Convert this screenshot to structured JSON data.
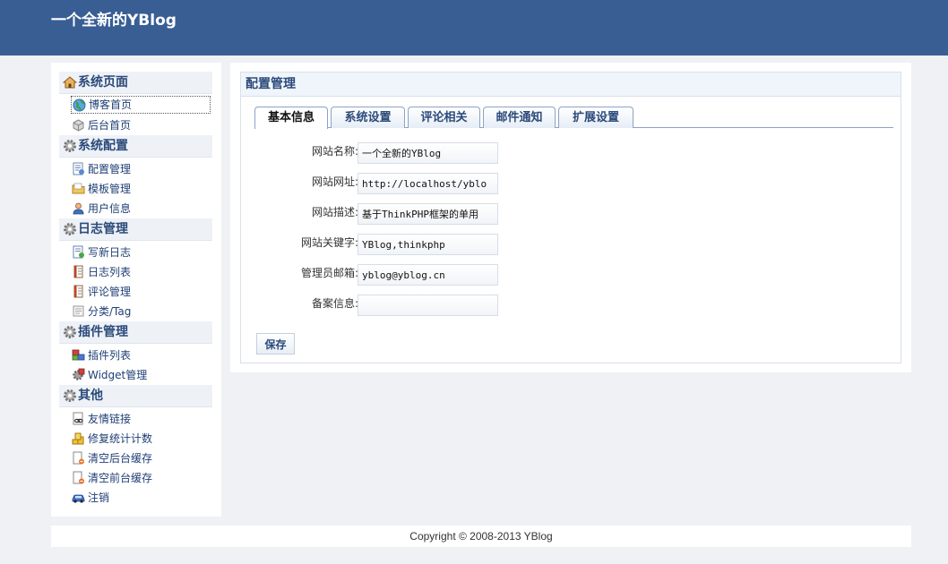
{
  "header": {
    "site_title": "一个全新的YBlog"
  },
  "sidebar": {
    "groups": [
      {
        "title": "系统页面",
        "icon": "home-icon",
        "items": [
          {
            "label": "博客首页",
            "icon": "globe-icon"
          },
          {
            "label": "后台首页",
            "icon": "box-icon"
          }
        ]
      },
      {
        "title": "系统配置",
        "icon": "gear-icon",
        "items": [
          {
            "label": "配置管理",
            "icon": "config-doc-icon"
          },
          {
            "label": "模板管理",
            "icon": "folder-icon"
          },
          {
            "label": "用户信息",
            "icon": "user-icon"
          }
        ]
      },
      {
        "title": "日志管理",
        "icon": "gear-icon",
        "items": [
          {
            "label": "写新日志",
            "icon": "new-doc-icon"
          },
          {
            "label": "日志列表",
            "icon": "book-icon"
          },
          {
            "label": "评论管理",
            "icon": "book-icon"
          },
          {
            "label": "分类/Tag",
            "icon": "text-doc-icon"
          }
        ]
      },
      {
        "title": "插件管理",
        "icon": "gear-icon",
        "items": [
          {
            "label": "插件列表",
            "icon": "plugin-icon"
          },
          {
            "label": "Widget管理",
            "icon": "widget-icon"
          }
        ]
      },
      {
        "title": "其他",
        "icon": "gear-icon",
        "items": [
          {
            "label": "友情链接",
            "icon": "link-doc-icon"
          },
          {
            "label": "修复统计计数",
            "icon": "coins-icon"
          },
          {
            "label": "清空后台缓存",
            "icon": "clear-doc-icon"
          },
          {
            "label": "清空前台缓存",
            "icon": "clear-doc-icon"
          },
          {
            "label": "注销",
            "icon": "car-icon"
          }
        ]
      }
    ]
  },
  "main": {
    "panel_title": "配置管理",
    "tabs": [
      {
        "label": "基本信息",
        "active": true
      },
      {
        "label": "系统设置",
        "active": false
      },
      {
        "label": "评论相关",
        "active": false
      },
      {
        "label": "邮件通知",
        "active": false
      },
      {
        "label": "扩展设置",
        "active": false
      }
    ],
    "fields": [
      {
        "label": "网站名称:",
        "value": "一个全新的YBlog"
      },
      {
        "label": "网站网址:",
        "value": "http://localhost/yblo"
      },
      {
        "label": "网站描述:",
        "value": "基于ThinkPHP框架的单用"
      },
      {
        "label": "网站关键字:",
        "value": "YBlog,thinkphp"
      },
      {
        "label": "管理员邮箱:",
        "value": "yblog@yblog.cn"
      },
      {
        "label": "备案信息:",
        "value": ""
      }
    ],
    "save_label": "保存"
  },
  "footer": {
    "text": "Copyright © 2008-2013 YBlog"
  },
  "colors": {
    "header_bg": "#385e94",
    "link": "#1f3f75",
    "heading": "#2b4a7a"
  }
}
